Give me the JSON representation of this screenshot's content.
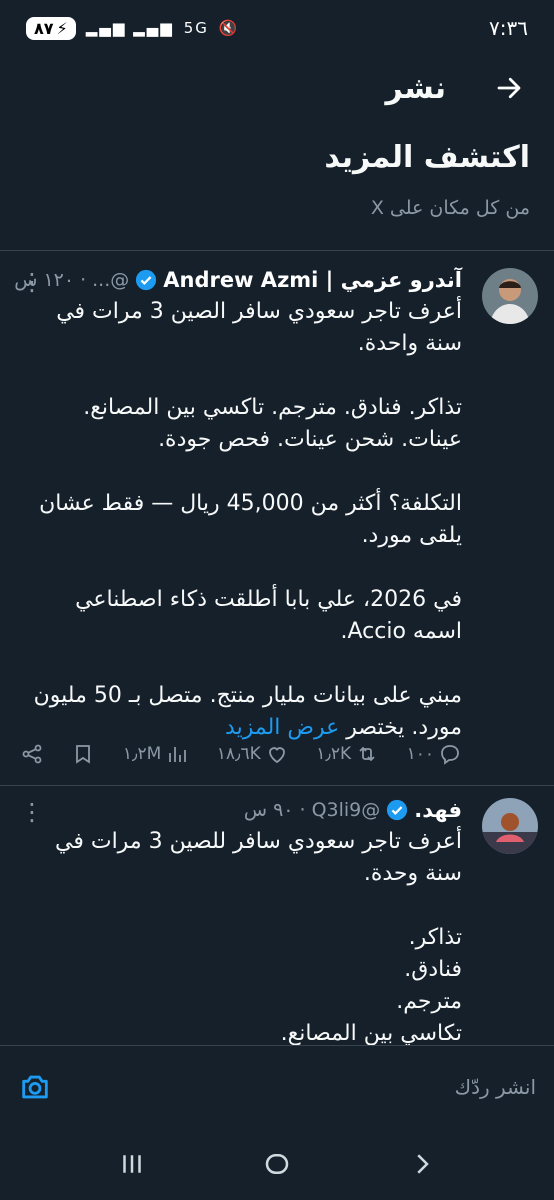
{
  "status_bar": {
    "time": "٧:٣٦",
    "battery": "٨٧",
    "icons": [
      "signal-icon",
      "signal-icon",
      "5g-icon",
      "mute-icon"
    ]
  },
  "header": {
    "title": "نشر",
    "back_icon": "arrow-right-icon"
  },
  "section": {
    "title": "اكتشف المزيد",
    "subtitle": "من كل مكان على X"
  },
  "tweets": [
    {
      "name": "آندرو عزمي | Andrew Azmi",
      "handle": "@...",
      "time": "١٢٠ س",
      "text": "أعرف تاجر سعودي سافر الصين 3 مرات في سنة واحدة.\n\nتذاكر. فنادق. مترجم. تاكسي بين المصانع. عينات. شحن عينات. فحص جودة.\n\nالتكلفة؟ أكثر من 45,000 ريال — فقط عشان يلقى مورد.\n\nفي 2026، علي بابا أطلقت ذكاء اصطناعي اسمه Accio.\n\nمبني على بيانات مليار منتج. متصل بـ 50 مليون مورد. يختصر",
      "show_more": "عرض المزيد",
      "replies": "١٠٠",
      "reposts": "١٫٢K",
      "likes": "١٨٫٦K",
      "views": "١٫٢M"
    },
    {
      "name": "فهد.",
      "handle": "@Q3li9",
      "time": "٩٠ س",
      "text": "أعرف تاجر سعودي سافر للصين 3 مرات في سنة وحدة.\n\nتذاكر.\nفنادق.\nمترجم.\nتكاسي بين المصانع."
    }
  ],
  "reply_bar": {
    "placeholder": "انشر ردّك"
  },
  "colors": {
    "background": "#15202b",
    "accent": "#1d9bf0",
    "secondary_text": "#8b98a5",
    "divider": "#38444d"
  }
}
